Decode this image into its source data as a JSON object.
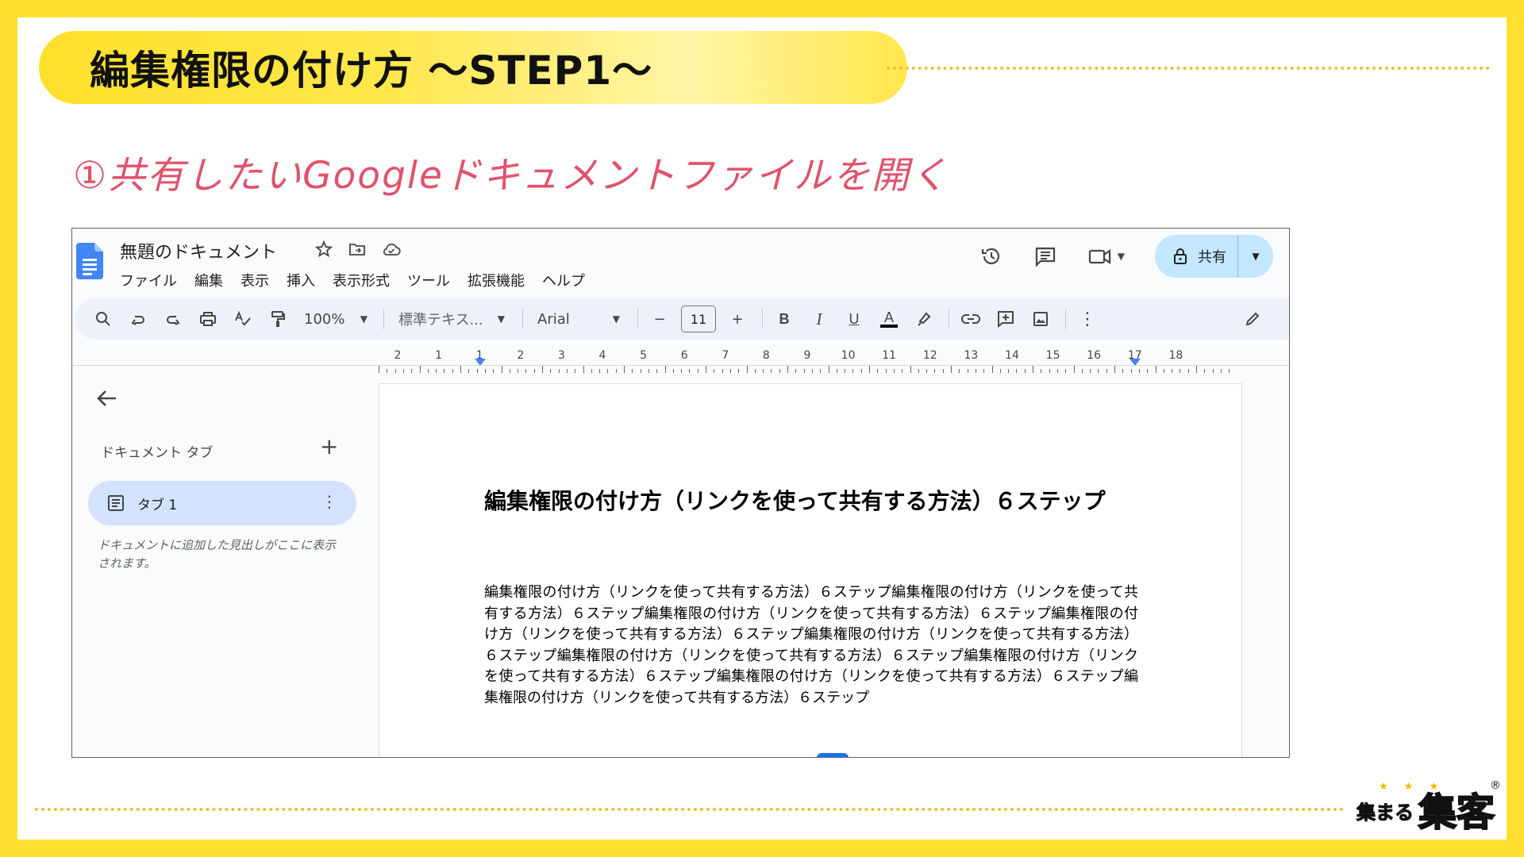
{
  "slide": {
    "title": "編集権限の付け方 〜STEP1〜",
    "step_text": "①共有したいGoogleドキュメントファイルを開く"
  },
  "colors": {
    "background": "#FFE033",
    "title_pill": "#FFE02A",
    "step_text": "#E0526B",
    "docs_blue": "#4285F4",
    "share_button": "#C2E7FF",
    "tab_selected": "#D3E3FD"
  },
  "logo": {
    "stars": "★ ★ ★",
    "small_text": "集まる",
    "big_text": "集客",
    "reg": "®"
  },
  "docs": {
    "doc_title": "無題のドキュメント",
    "menu": [
      "ファイル",
      "編集",
      "表示",
      "挿入",
      "表示形式",
      "ツール",
      "拡張機能",
      "ヘルプ"
    ],
    "share_label": "共有",
    "toolbar": {
      "zoom": "100%",
      "style": "標準テキス...",
      "font": "Arial",
      "font_size": "11",
      "minus": "−",
      "plus": "+"
    },
    "ruler_labels": [
      "2",
      "1",
      "1",
      "2",
      "3",
      "4",
      "5",
      "6",
      "7",
      "8",
      "9",
      "10",
      "11",
      "12",
      "13",
      "14",
      "15",
      "16",
      "17",
      "18"
    ],
    "sidebar": {
      "tabs_header": "ドキュメント タブ",
      "add": "+",
      "tab_label": "タブ 1",
      "more": "⋮",
      "hint": "ドキュメントに追加した見出しがここに表示されます。"
    },
    "page": {
      "heading": "編集権限の付け方（リンクを使って共有する方法）６ステップ",
      "body": "編集権限の付け方（リンクを使って共有する方法）６ステップ編集権限の付け方（リンクを使って共有する方法）６ステップ編集権限の付け方（リンクを使って共有する方法）６ステップ編集権限の付け方（リンクを使って共有する方法）６ステップ編集権限の付け方（リンクを使って共有する方法）６ステップ編集権限の付け方（リンクを使って共有する方法）６ステップ編集権限の付け方（リンクを使って共有する方法）６ステップ編集権限の付け方（リンクを使って共有する方法）６ステップ編集権限の付け方（リンクを使って共有する方法）６ステップ"
    }
  }
}
